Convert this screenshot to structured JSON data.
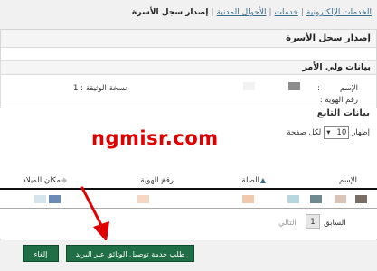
{
  "breadcrumb": {
    "items": [
      "الخدمات الإلكترونية",
      "خدمات",
      "الأحوال المدنية"
    ],
    "current": "إصدار سجل الأسرة"
  },
  "main_panel": {
    "title": "إصدار سجل الأسرة"
  },
  "guardian": {
    "title": "بيانات ولي الأمر",
    "name_label": "الإسم",
    "colon": ":",
    "id_label": "رقم الهوية :",
    "copy_label": "نسخة الوثيقة :",
    "copy_value": "1"
  },
  "followers": {
    "title": "بيانات التابع",
    "show_label": "إظهار",
    "page_size": "10",
    "per_page_label": "لكل صفحة",
    "columns": [
      "الإسم",
      "الصلة",
      "رقم الهوية",
      "مكان الميلاد"
    ],
    "pager": {
      "prev": "السابق",
      "page": "1",
      "next": "التالي"
    }
  },
  "watermark": "ngmisr.com",
  "buttons": {
    "request": "طلب خدمة توصيل الوثائق عبر البريد",
    "cancel": "إلغاء"
  },
  "colors": {
    "accent_button": "#1f6e45",
    "watermark": "#e10000",
    "link": "#3c6e8a"
  }
}
